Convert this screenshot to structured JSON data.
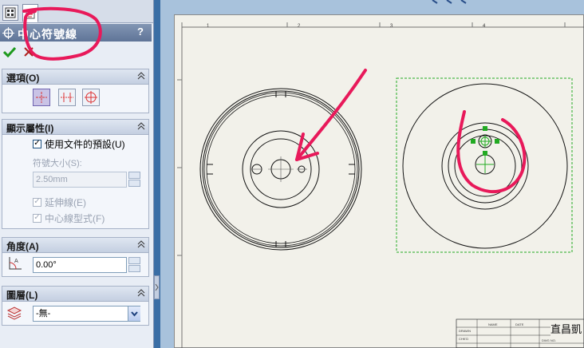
{
  "panel": {
    "title": "中心符號線",
    "help": "?",
    "groups": {
      "options": {
        "label": "選項(O)"
      },
      "display": {
        "label": "顯示屬性(I)",
        "use_doc_defaults": "使用文件的預設(U)",
        "symbol_size_label": "符號大小(S):",
        "symbol_size_value": "2.50mm",
        "extended_lines": "延伸線(E)",
        "centerline_font": "中心線型式(F)"
      },
      "angle": {
        "label": "角度(A)",
        "value": "0.00°"
      },
      "layer": {
        "label": "圖層(L)",
        "value": "-無-"
      }
    }
  },
  "drawing": {
    "ruler_numbers": [
      "1",
      "2",
      "3",
      "4"
    ],
    "title_block_name": "直昌凱",
    "title_block_labels": [
      "DRAWN",
      "CHK'D",
      "NAME",
      "DATE",
      "DWG NO."
    ]
  },
  "colors": {
    "annotation": "#e8195a",
    "selection": "#22aa22",
    "titlebar": "#6a7fa3"
  }
}
